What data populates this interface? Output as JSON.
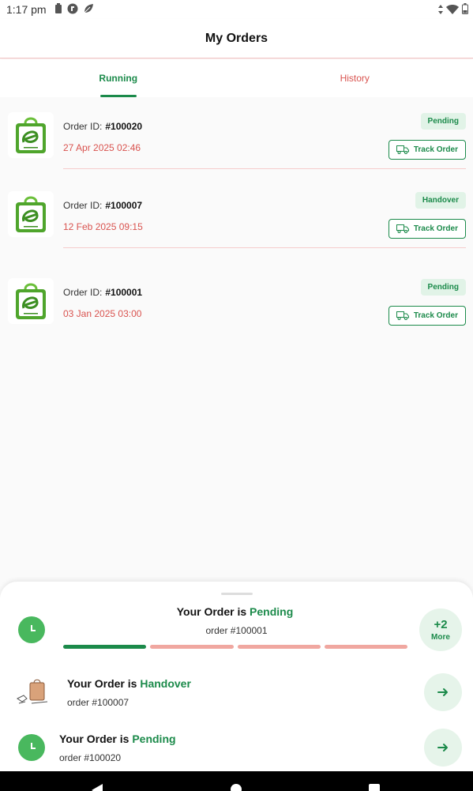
{
  "status_bar": {
    "time": "1:17 pm"
  },
  "header": {
    "title": "My Orders"
  },
  "tabs": [
    {
      "label": "Running",
      "active": true
    },
    {
      "label": "History",
      "active": false
    }
  ],
  "orders": [
    {
      "id_label": "Order ID:",
      "id": "#100020",
      "date": "27 Apr 2025  02:46",
      "status": "Pending",
      "track_label": "Track Order",
      "logo_text": ""
    },
    {
      "id_label": "Order ID:",
      "id": "#100007",
      "date": "12 Feb 2025  09:15",
      "status": "Handover",
      "track_label": "Track Order",
      "logo_text": ""
    },
    {
      "id_label": "Order ID:",
      "id": "#100001",
      "date": "03 Jan 2025  03:00",
      "status": "Pending",
      "track_label": "Track Order",
      "logo_text": ""
    }
  ],
  "tracker": {
    "primary": {
      "prefix": "Your Order is ",
      "status": "Pending",
      "order": "order #100001",
      "progress_steps_done": 1,
      "progress_steps_total": 4
    },
    "more": {
      "count": "+2",
      "label": "More"
    },
    "items": [
      {
        "prefix": "Your Order is ",
        "status": "Handover",
        "order": "order #100007"
      },
      {
        "prefix": "Your Order is ",
        "status": "Pending",
        "order": "order #100020"
      }
    ]
  },
  "colors": {
    "accent": "#1b8a4a",
    "danger": "#d9534f",
    "pending_badge_bg": "#e1f3e7"
  }
}
